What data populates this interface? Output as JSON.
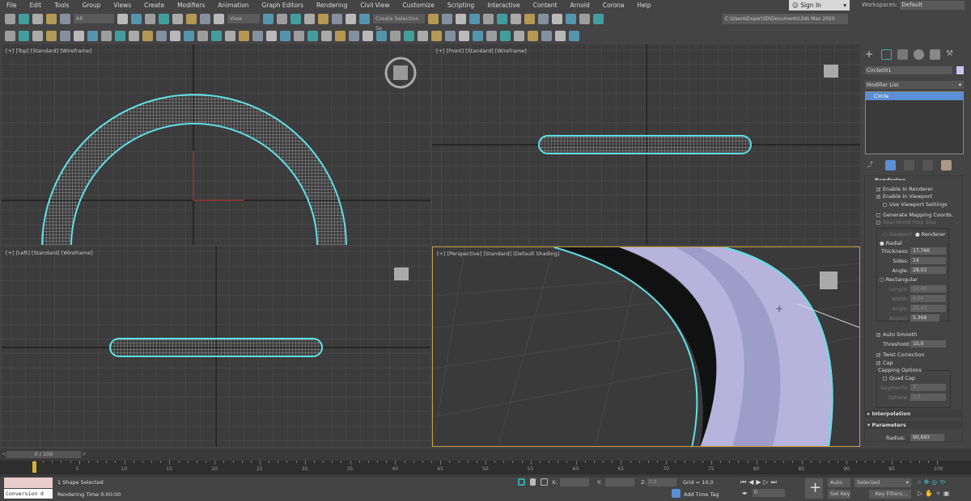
{
  "menu": [
    "File",
    "Edit",
    "Tools",
    "Group",
    "Views",
    "Create",
    "Modifiers",
    "Animation",
    "Graph Editors",
    "Rendering",
    "Civil View",
    "Customize",
    "Scripting",
    "Interactive",
    "Content",
    "Arnold",
    "Corona",
    "Help"
  ],
  "signin": "Sign In",
  "workspaces": {
    "label": "Workspaces:",
    "value": "Default"
  },
  "toolbar": {
    "filter": "All",
    "ref_coord": "View",
    "selection_set": "Create Selection Se",
    "project_path": "C:\\Users\\Expert3D\\Documents\\3ds Max 2020",
    "icons1": [
      "undo-icon",
      "redo-icon",
      "link-icon",
      "unlink-icon",
      "bind-spacewarp-icon",
      "select-object-icon",
      "select-by-name-icon",
      "rect-selection-icon",
      "window-crossing-icon",
      "move-icon",
      "rotate-icon",
      "scale-icon",
      "placement-icon",
      "use-pivot-icon",
      "select-manipulate-icon",
      "keyboard-shortcut-icon",
      "snaps-toggle-icon",
      "angle-snap-icon",
      "percent-snap-icon",
      "spinner-snap-icon",
      "edit-named-selection-icon"
    ],
    "icons1b": [
      "mirror-icon",
      "align-icon",
      "toggle-scene-explorer-icon",
      "toggle-layer-explorer-icon",
      "ribbon-icon",
      "curve-editor-icon",
      "dope-sheet-icon",
      "schematic-view-icon",
      "material-editor-icon",
      "render-setup-icon",
      "rendered-frame-icon",
      "render-production-icon",
      "render-iterative-icon"
    ],
    "icons2": [
      "teapot-icon",
      "cloud-icon",
      "render-icon",
      "table-icon",
      "panel-icon",
      "light-icon",
      "camera-icon",
      "sphere-icon",
      "material-icon",
      "plane-icon",
      "dome-icon",
      "ball-icon",
      "bowl-icon",
      "cone-icon",
      "sun-icon",
      "disk-icon",
      "particles-icon",
      "atom-icon",
      "rig-icon",
      "gear-icon",
      "plant-icon",
      "animal-icon",
      "sphere-rock-icon",
      "globe-icon",
      "snapshot-icon",
      "toggle-icon",
      "help-icon",
      "bulb-icon",
      "dot-icon",
      "people-icon",
      "tree-icon",
      "list-icon",
      "bottle-icon",
      "box-icon",
      "torus-icon",
      "frame-icon",
      "grid-icon",
      "play-icon",
      "cube-icon",
      "window-icon",
      "teapot2-icon",
      "bulb2-icon"
    ]
  },
  "viewports": [
    {
      "label": "[+] [Top] [Standard] [Wireframe]"
    },
    {
      "label": "[+] [Front] [Standard] [Wireframe]"
    },
    {
      "label": "[+] [Left] [Standard] [Wireframe]"
    },
    {
      "label": "[+] [Perspective] [Standard] [Default Shading]"
    }
  ],
  "panel": {
    "object_name": "Circle001",
    "object_color": "#c8c4f0",
    "modifier_list": "Modifier List",
    "stack": [
      "Circle"
    ],
    "rollout_title": "Rendering",
    "enable_renderer": "Enable In Renderer",
    "enable_viewport": "Enable In Viewport",
    "use_viewport_settings": "Use Viewport Settings",
    "gen_mapping": "Generate Mapping Coords.",
    "real_world": "Real-World Map Size",
    "viewport": "Viewport",
    "renderer": "Renderer",
    "radial": "Radial",
    "thickness": {
      "label": "Thickness:",
      "value": "17,766"
    },
    "sides": {
      "label": "Sides:",
      "value": "14"
    },
    "angle": {
      "label": "Angle:",
      "value": "28,03"
    },
    "rectangular": "Rectangular",
    "length": {
      "label": "Length:",
      "value": "24,48"
    },
    "width": {
      "label": "Width:",
      "value": "4,56"
    },
    "angle2": {
      "label": "Angle:",
      "value": "22,43"
    },
    "aspect": {
      "label": "Aspect:",
      "value": "5,368"
    },
    "auto_smooth": "Auto Smooth",
    "threshold": {
      "label": "Threshold:",
      "value": "10,0"
    },
    "twist": "Twist Correction",
    "cap": "Cap",
    "capping_options": "Capping Options",
    "quad_cap": "Quad Cap",
    "segments": {
      "label": "Segments:",
      "value": "3"
    },
    "sphere": {
      "label": "Sphere:",
      "value": "1,0"
    },
    "interpolation": "Interpolation",
    "parameters": "Parameters",
    "radius": {
      "label": "Radius:",
      "value": "90,693"
    }
  },
  "timeline": {
    "frame": "0 / 100",
    "ticks": [
      "5",
      "10",
      "15",
      "20",
      "25",
      "30",
      "35",
      "40",
      "45",
      "50",
      "55",
      "60",
      "65",
      "70",
      "75",
      "80",
      "85",
      "90",
      "95",
      "100"
    ],
    "position": 0
  },
  "status": {
    "listener": "Conversion d",
    "selected": "1 Shape Selected",
    "render_time": "Rendering Time  0:00:00",
    "x_label": "X:",
    "y_label": "Y:",
    "z_label": "Z:",
    "z_value": "0,0",
    "grid": "Grid = 10,0",
    "add_time_tag": "Add Time Tag",
    "auto_key": "Auto Key",
    "set_key": "Set Key",
    "selected_dd": "Selected",
    "key_filters": "Key Filters...",
    "frame_value": "0"
  }
}
